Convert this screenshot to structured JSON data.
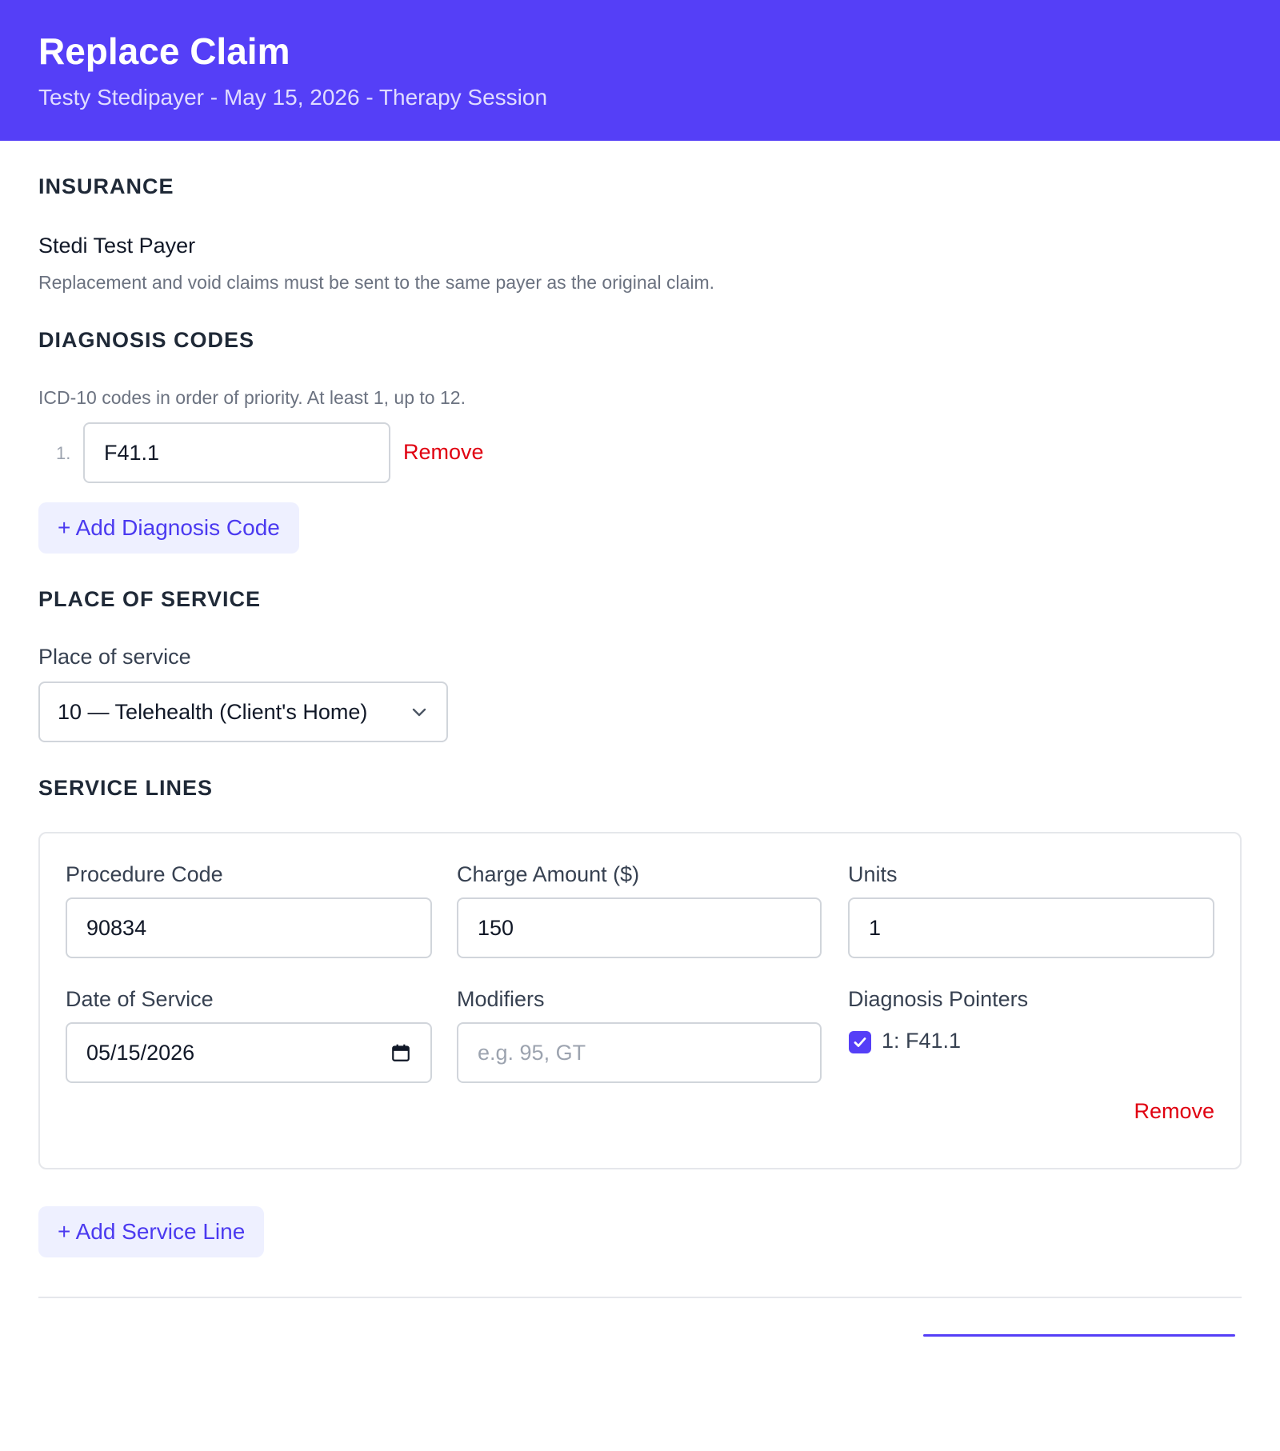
{
  "header": {
    "title": "Replace Claim",
    "subtitle": "Testy Stedipayer - May 15, 2026 - Therapy Session"
  },
  "insurance": {
    "heading": "INSURANCE",
    "payer_name": "Stedi Test Payer",
    "note": "Replacement and void claims must be sent to the same payer as the original claim."
  },
  "diagnosis": {
    "heading": "DIAGNOSIS CODES",
    "help": "ICD-10 codes in order of priority. At least 1, up to 12.",
    "codes": [
      {
        "index": "1.",
        "value": "F41.1",
        "remove_label": "Remove"
      }
    ],
    "add_label": "+ Add Diagnosis Code"
  },
  "place_of_service": {
    "heading": "PLACE OF SERVICE",
    "label": "Place of service",
    "selected": "10 — Telehealth (Client's Home)",
    "icon": "chevron-down-icon"
  },
  "service_lines": {
    "heading": "SERVICE LINES",
    "lines": [
      {
        "procedure_code_label": "Procedure Code",
        "procedure_code": "90834",
        "charge_label": "Charge Amount ($)",
        "charge": "150",
        "units_label": "Units",
        "units": "1",
        "date_label": "Date of Service",
        "date": "05/15/2026",
        "modifiers_label": "Modifiers",
        "modifiers": "",
        "modifiers_placeholder": "e.g. 95, GT",
        "pointers_label": "Diagnosis Pointers",
        "pointers": [
          {
            "label": "1: F41.1",
            "checked": true
          }
        ],
        "remove_label": "Remove"
      }
    ],
    "add_label": "+ Add Service Line"
  },
  "colors": {
    "brand": "#553ff7",
    "danger": "#e00010",
    "button_bg": "#eef0ff"
  }
}
